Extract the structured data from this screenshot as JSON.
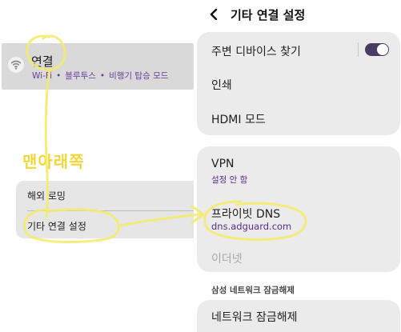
{
  "left_panel": {
    "connections": {
      "title": "연결",
      "sub_wifi": "Wi-Fi",
      "sub_bt": "블루투스",
      "sub_airplane": "비행기 탑승 모드",
      "separator": "•"
    },
    "annotation_text": "맨아래쪽",
    "list_items": [
      "해외 로밍",
      "기타 연결 설정"
    ]
  },
  "header": {
    "title": "기타 연결 설정"
  },
  "card1": {
    "nearby_device_scan": "주변 디바이스 찾기",
    "nearby_toggle_on": true,
    "printing": "인쇄",
    "hdmi_mode": "HDMI 모드"
  },
  "card2": {
    "vpn": "VPN",
    "vpn_status": "설정 안 함",
    "private_dns": "프라이빗 DNS",
    "private_dns_value": "dns.adguard.com",
    "ethernet": "이더넷"
  },
  "section": {
    "samsung_unlock_label": "삼성 네트워크 잠금해제"
  },
  "card3": {
    "network_unlock": "네트워크 잠금해제"
  },
  "colors": {
    "accent_purple": "#5a2d8c",
    "annotation_yellow": "#f5e96a",
    "card_bg": "#ebebeb"
  }
}
